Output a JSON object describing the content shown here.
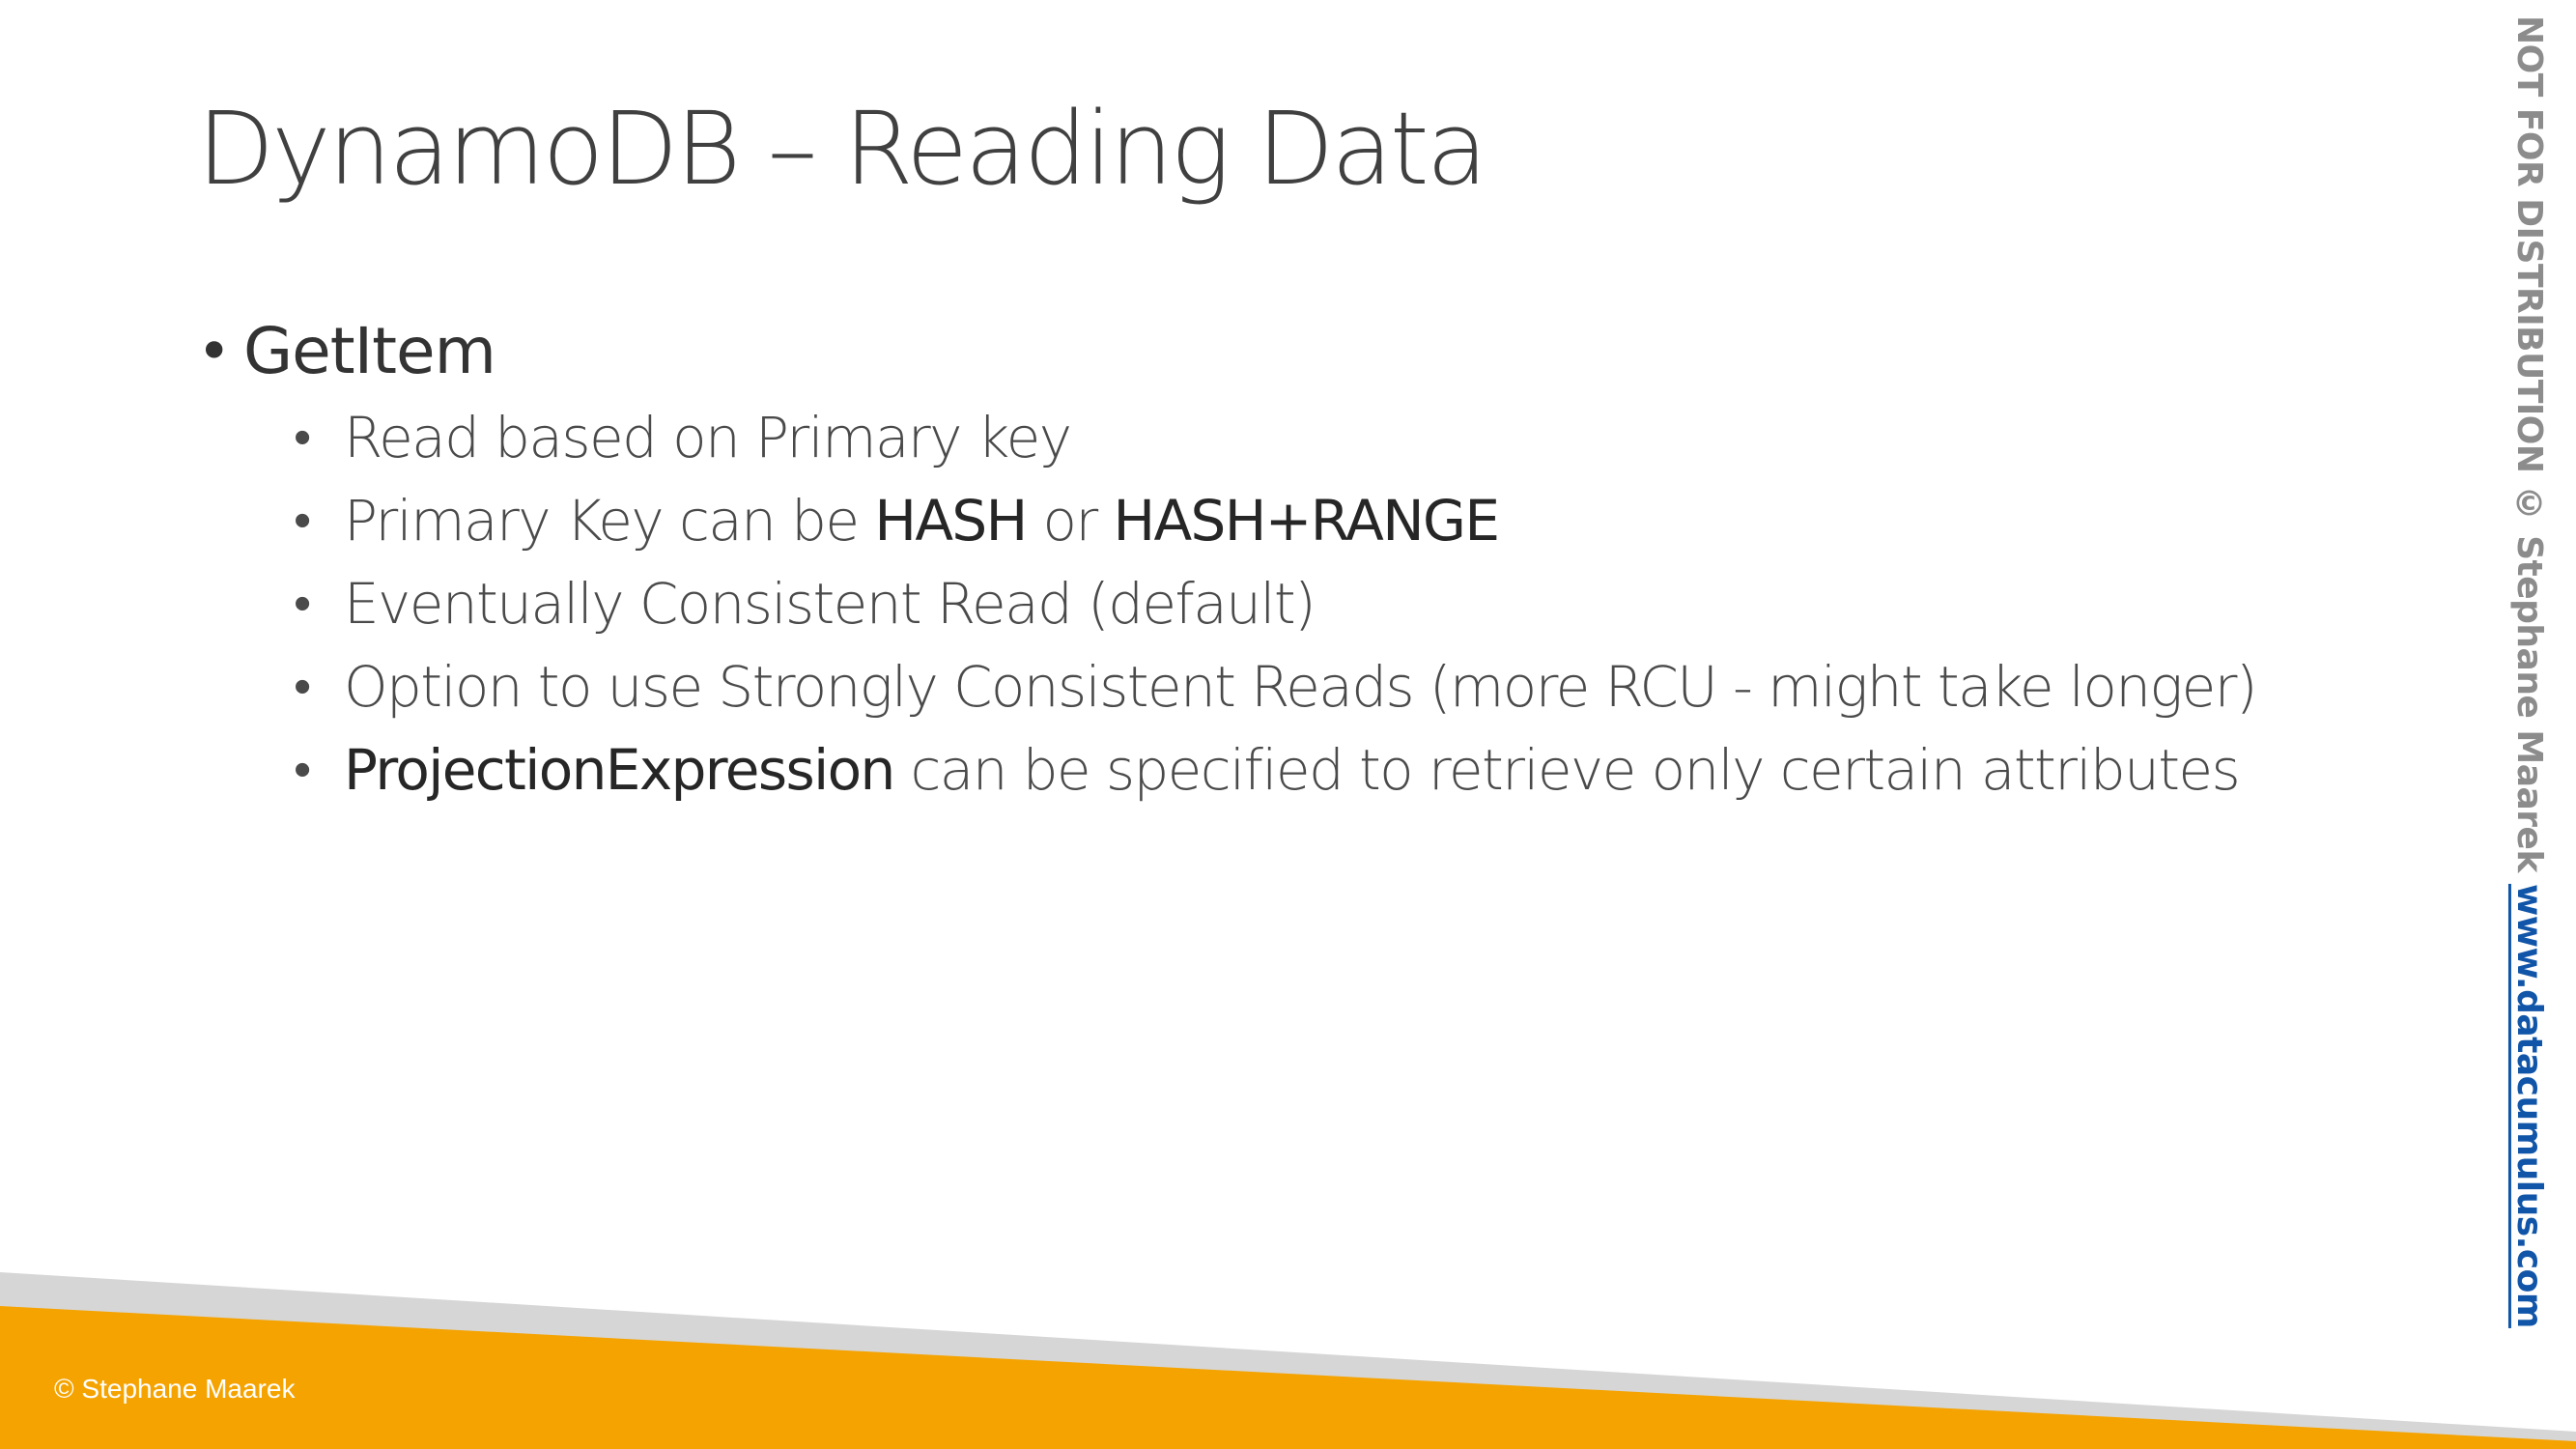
{
  "slide": {
    "title": "DynamoDB – Reading Data",
    "bullet_glyph": "•",
    "main_bullet": "GetItem",
    "sub_bullets": [
      {
        "parts": [
          {
            "text": "Read based on Primary key",
            "emphasis": false
          }
        ]
      },
      {
        "parts": [
          {
            "text": "Primary Key can be ",
            "emphasis": false
          },
          {
            "text": "HASH",
            "emphasis": true
          },
          {
            "text": " or ",
            "emphasis": false
          },
          {
            "text": "HASH+RANGE",
            "emphasis": true
          }
        ]
      },
      {
        "parts": [
          {
            "text": "Eventually Consistent Read (default)",
            "emphasis": false
          }
        ]
      },
      {
        "parts": [
          {
            "text": "Option to use Strongly Consistent Reads (more RCU - might take longer)",
            "emphasis": false
          }
        ]
      },
      {
        "parts": [
          {
            "text": "ProjectionExpression",
            "emphasis": true
          },
          {
            "text": " can be specified to retrieve only certain attributes",
            "emphasis": false
          }
        ]
      }
    ]
  },
  "sidebar": {
    "notice": "NOT FOR DISTRIBUTION © Stephane Maarek ",
    "url": "www.datacumulus.com"
  },
  "footer": {
    "credit": "© Stephane Maarek"
  },
  "colors": {
    "title": "#404040",
    "text": "#4a4a4a",
    "emphasis": "#262626",
    "footer_orange": "#f5a300",
    "footer_gray": "#d6d6d6",
    "side_notice": "#8c8c8c",
    "side_url": "#1155a8"
  }
}
